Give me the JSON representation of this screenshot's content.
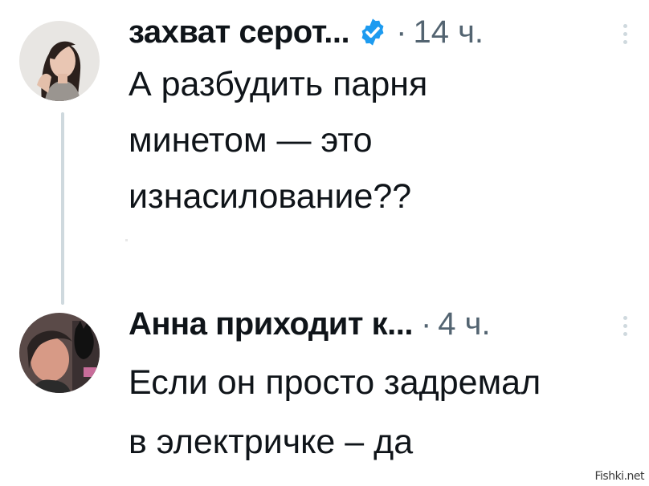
{
  "tweets": [
    {
      "author": "захват серот...",
      "verified": true,
      "separator": "·",
      "time": "14 ч.",
      "text_lines": [
        "А разбудить парня",
        "минетом — это",
        "изнасилование??"
      ],
      "avatar_icon": "user-avatar-woman"
    },
    {
      "author": "Анна приходит к...",
      "verified": false,
      "separator": "·",
      "time": "4 ч.",
      "text_lines": [
        "Если он просто задремал",
        "в электричке – да"
      ],
      "avatar_icon": "user-avatar-woman-with-cat"
    }
  ],
  "watermark": "Fishki.net",
  "colors": {
    "text": "#0f1419",
    "secondary": "#536471",
    "verified_badge": "#1d9bf0",
    "thread_line": "#cfd9de"
  }
}
